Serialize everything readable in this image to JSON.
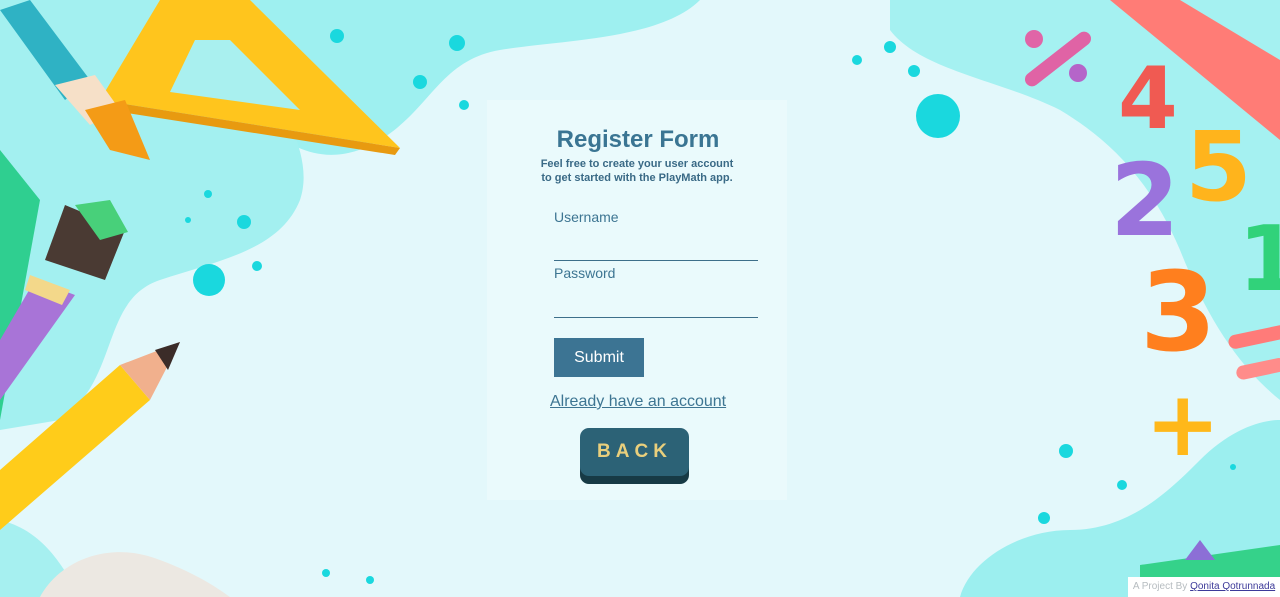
{
  "form": {
    "title": "Register Form",
    "subtitle_line1": "Feel free to create your user account",
    "subtitle_line2": "to get started with the PlayMath app.",
    "username_label": "Username",
    "username_value": "",
    "password_label": "Password",
    "password_value": "",
    "submit_label": "Submit",
    "login_link": "Already have an account"
  },
  "back_button": {
    "label": "BACK"
  },
  "footer": {
    "prefix": "A Project By",
    "author": "Qonita Qotrunnada"
  },
  "colors": {
    "background": "#e3f8fb",
    "blob": "#9ef0f0",
    "primary": "#3c7493",
    "back_button": "#2c6276",
    "back_text": "#e9cf7c"
  },
  "decorations": {
    "numbers": [
      "4",
      "5",
      "2",
      "3",
      "1",
      "+"
    ],
    "icons": [
      "triangle-ruler-icon",
      "paintbrush-icon",
      "pencil-icon",
      "ruler-icon"
    ]
  }
}
